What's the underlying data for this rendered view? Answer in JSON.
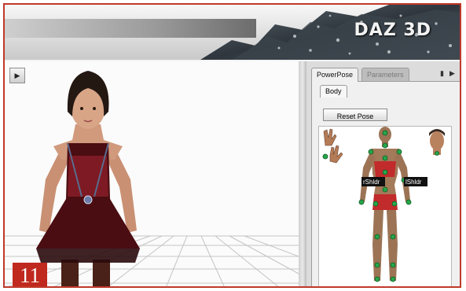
{
  "banner": {
    "logo_text": "DAZ 3D"
  },
  "viewport": {
    "play_icon": "play-icon"
  },
  "panel": {
    "tabs": [
      {
        "label": "PowerPose",
        "active": true
      },
      {
        "label": "Parameters",
        "active": false
      }
    ],
    "pin_icon": "pin-icon",
    "next_icon": "next-icon",
    "subtab_label": "Body",
    "reset_button_label": "Reset Pose",
    "tooltip_left": "rShldr",
    "tooltip_right": "lShldr",
    "hand_icons": [
      "right-hand-icon",
      "left-hand-icon"
    ],
    "head_icon": "head-icon"
  },
  "badge": {
    "number": "11"
  },
  "colors": {
    "accent_red": "#c0291e",
    "control_point": "#27a54a",
    "outfit": "#b0222a"
  }
}
